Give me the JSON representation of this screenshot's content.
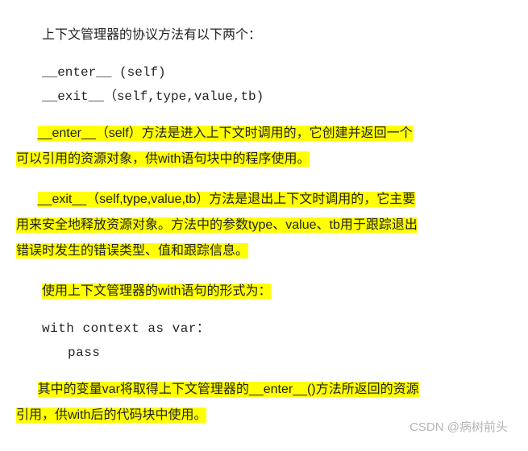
{
  "intro": "上下文管理器的协议方法有以下两个：",
  "sig": {
    "enter": "__enter__ (self)",
    "exit": "__exit__（self,type,value,tb)"
  },
  "enter_desc": {
    "l1": "__enter__（self）方法是进入上下文时调用的，它创建并返回一个",
    "l2": "可以引用的资源对象，供with语句块中的程序使用。"
  },
  "exit_desc": {
    "l1": "__exit__（self,type,value,tb）方法是退出上下文时调用的，它主要",
    "l2": "用来安全地释放资源对象。方法中的参数type、value、tb用于跟踪退出",
    "l3": "错误时发生的错误类型、值和跟踪信息。"
  },
  "with_intro": "使用上下文管理器的with语句的形式为：",
  "with_code": {
    "l1": "with context as var：",
    "l2": "pass"
  },
  "var_desc": {
    "l1": "其中的变量var将取得上下文管理器的__enter__()方法所返回的资源",
    "l2": "引用，供with后的代码块中使用。"
  },
  "watermark": "CSDN @病树前头"
}
